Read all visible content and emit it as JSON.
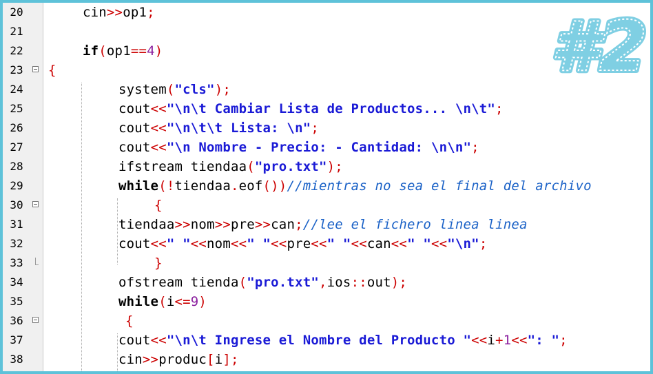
{
  "badge": {
    "text": "#2",
    "color": "#7fcfe3"
  },
  "colors": {
    "keyword": "#000000",
    "operator": "#cc0000",
    "string": "#1a1ad6",
    "comment": "#1b62c7",
    "number": "#8a1e9e"
  },
  "lines": [
    {
      "num": "20",
      "fold": "",
      "indent": 1,
      "tokens": [
        {
          "t": "cin",
          "c": "plain"
        },
        {
          "t": ">>",
          "c": "op"
        },
        {
          "t": "op1",
          "c": "plain"
        },
        {
          "t": ";",
          "c": "op"
        }
      ]
    },
    {
      "num": "21",
      "fold": "",
      "indent": 1,
      "tokens": []
    },
    {
      "num": "22",
      "fold": "",
      "indent": 1,
      "tokens": [
        {
          "t": "if",
          "c": "kw"
        },
        {
          "t": "(",
          "c": "op"
        },
        {
          "t": "op1",
          "c": "plain"
        },
        {
          "t": "==",
          "c": "op"
        },
        {
          "t": "4",
          "c": "num"
        },
        {
          "t": ")",
          "c": "op"
        }
      ]
    },
    {
      "num": "23",
      "fold": "box",
      "indent": 0,
      "tokens": [
        {
          "t": "{",
          "c": "op"
        }
      ]
    },
    {
      "num": "24",
      "fold": "",
      "indent": 2,
      "tokens": [
        {
          "t": "system",
          "c": "plain"
        },
        {
          "t": "(",
          "c": "op"
        },
        {
          "t": "\"cls\"",
          "c": "str"
        },
        {
          "t": ");",
          "c": "op"
        }
      ]
    },
    {
      "num": "25",
      "fold": "",
      "indent": 2,
      "tokens": [
        {
          "t": "cout",
          "c": "plain"
        },
        {
          "t": "<<",
          "c": "op"
        },
        {
          "t": "\"\\n\\t Cambiar Lista de Productos... \\n\\t\"",
          "c": "str"
        },
        {
          "t": ";",
          "c": "op"
        }
      ]
    },
    {
      "num": "26",
      "fold": "",
      "indent": 2,
      "tokens": [
        {
          "t": "cout",
          "c": "plain"
        },
        {
          "t": "<<",
          "c": "op"
        },
        {
          "t": "\"\\n\\t\\t Lista: \\n\"",
          "c": "str"
        },
        {
          "t": ";",
          "c": "op"
        }
      ]
    },
    {
      "num": "27",
      "fold": "",
      "indent": 2,
      "tokens": [
        {
          "t": "cout",
          "c": "plain"
        },
        {
          "t": "<<",
          "c": "op"
        },
        {
          "t": "\"\\n Nombre - Precio: - Cantidad: \\n\\n\"",
          "c": "str"
        },
        {
          "t": ";",
          "c": "op"
        }
      ]
    },
    {
      "num": "28",
      "fold": "",
      "indent": 2,
      "tokens": [
        {
          "t": "ifstream tiendaa",
          "c": "plain"
        },
        {
          "t": "(",
          "c": "op"
        },
        {
          "t": "\"pro.txt\"",
          "c": "str"
        },
        {
          "t": ");",
          "c": "op"
        }
      ]
    },
    {
      "num": "29",
      "fold": "",
      "indent": 2,
      "tokens": [
        {
          "t": "while",
          "c": "kw"
        },
        {
          "t": "(!",
          "c": "op"
        },
        {
          "t": "tiendaa",
          "c": "plain"
        },
        {
          "t": ".",
          "c": "op"
        },
        {
          "t": "eof",
          "c": "plain"
        },
        {
          "t": "())",
          "c": "op"
        },
        {
          "t": "//mientras no sea el final del archivo",
          "c": "cm"
        }
      ]
    },
    {
      "num": "30",
      "fold": "box",
      "indent": 3,
      "tokens": [
        {
          "t": "{",
          "c": "op"
        }
      ]
    },
    {
      "num": "31",
      "fold": "",
      "indent": 2,
      "tokens": [
        {
          "t": "tiendaa",
          "c": "plain"
        },
        {
          "t": ">>",
          "c": "op"
        },
        {
          "t": "nom",
          "c": "plain"
        },
        {
          "t": ">>",
          "c": "op"
        },
        {
          "t": "pre",
          "c": "plain"
        },
        {
          "t": ">>",
          "c": "op"
        },
        {
          "t": "can",
          "c": "plain"
        },
        {
          "t": ";",
          "c": "op"
        },
        {
          "t": "//lee el fichero linea linea",
          "c": "cm"
        }
      ]
    },
    {
      "num": "32",
      "fold": "",
      "indent": 2,
      "tokens": [
        {
          "t": "cout",
          "c": "plain"
        },
        {
          "t": "<<",
          "c": "op"
        },
        {
          "t": "\" \"",
          "c": "str"
        },
        {
          "t": "<<",
          "c": "op"
        },
        {
          "t": "nom",
          "c": "plain"
        },
        {
          "t": "<<",
          "c": "op"
        },
        {
          "t": "\" \"",
          "c": "str"
        },
        {
          "t": "<<",
          "c": "op"
        },
        {
          "t": "pre",
          "c": "plain"
        },
        {
          "t": "<<",
          "c": "op"
        },
        {
          "t": "\" \"",
          "c": "str"
        },
        {
          "t": "<<",
          "c": "op"
        },
        {
          "t": "can",
          "c": "plain"
        },
        {
          "t": "<<",
          "c": "op"
        },
        {
          "t": "\" \"",
          "c": "str"
        },
        {
          "t": "<<",
          "c": "op"
        },
        {
          "t": "\"\\n\"",
          "c": "str"
        },
        {
          "t": ";",
          "c": "op"
        }
      ]
    },
    {
      "num": "33",
      "fold": "end",
      "indent": 3,
      "tokens": [
        {
          "t": "}",
          "c": "op"
        }
      ]
    },
    {
      "num": "34",
      "fold": "",
      "indent": 2,
      "tokens": [
        {
          "t": "ofstream tienda",
          "c": "plain"
        },
        {
          "t": "(",
          "c": "op"
        },
        {
          "t": "\"pro.txt\"",
          "c": "str"
        },
        {
          "t": ",",
          "c": "op"
        },
        {
          "t": "ios",
          "c": "plain"
        },
        {
          "t": "::",
          "c": "op"
        },
        {
          "t": "out",
          "c": "plain"
        },
        {
          "t": ");",
          "c": "op"
        }
      ]
    },
    {
      "num": "35",
      "fold": "",
      "indent": 2,
      "tokens": [
        {
          "t": "while",
          "c": "kw"
        },
        {
          "t": "(",
          "c": "op"
        },
        {
          "t": "i",
          "c": "plain"
        },
        {
          "t": "<=",
          "c": "op"
        },
        {
          "t": "9",
          "c": "num"
        },
        {
          "t": ")",
          "c": "op"
        }
      ]
    },
    {
      "num": "36",
      "fold": "box",
      "indent": 2,
      "pad": 1,
      "tokens": [
        {
          "t": "{",
          "c": "op"
        }
      ]
    },
    {
      "num": "37",
      "fold": "",
      "indent": 2,
      "tokens": [
        {
          "t": "cout",
          "c": "plain"
        },
        {
          "t": "<<",
          "c": "op"
        },
        {
          "t": "\"\\n\\t Ingrese el Nombre del Producto \"",
          "c": "str"
        },
        {
          "t": "<<",
          "c": "op"
        },
        {
          "t": "i",
          "c": "plain"
        },
        {
          "t": "+",
          "c": "op"
        },
        {
          "t": "1",
          "c": "num"
        },
        {
          "t": "<<",
          "c": "op"
        },
        {
          "t": "\": \"",
          "c": "str"
        },
        {
          "t": ";",
          "c": "op"
        }
      ]
    },
    {
      "num": "38",
      "fold": "",
      "indent": 2,
      "tokens": [
        {
          "t": "cin",
          "c": "plain"
        },
        {
          "t": ">>",
          "c": "op"
        },
        {
          "t": "produc",
          "c": "plain"
        },
        {
          "t": "[",
          "c": "op"
        },
        {
          "t": "i",
          "c": "plain"
        },
        {
          "t": "];",
          "c": "op"
        }
      ]
    }
  ]
}
